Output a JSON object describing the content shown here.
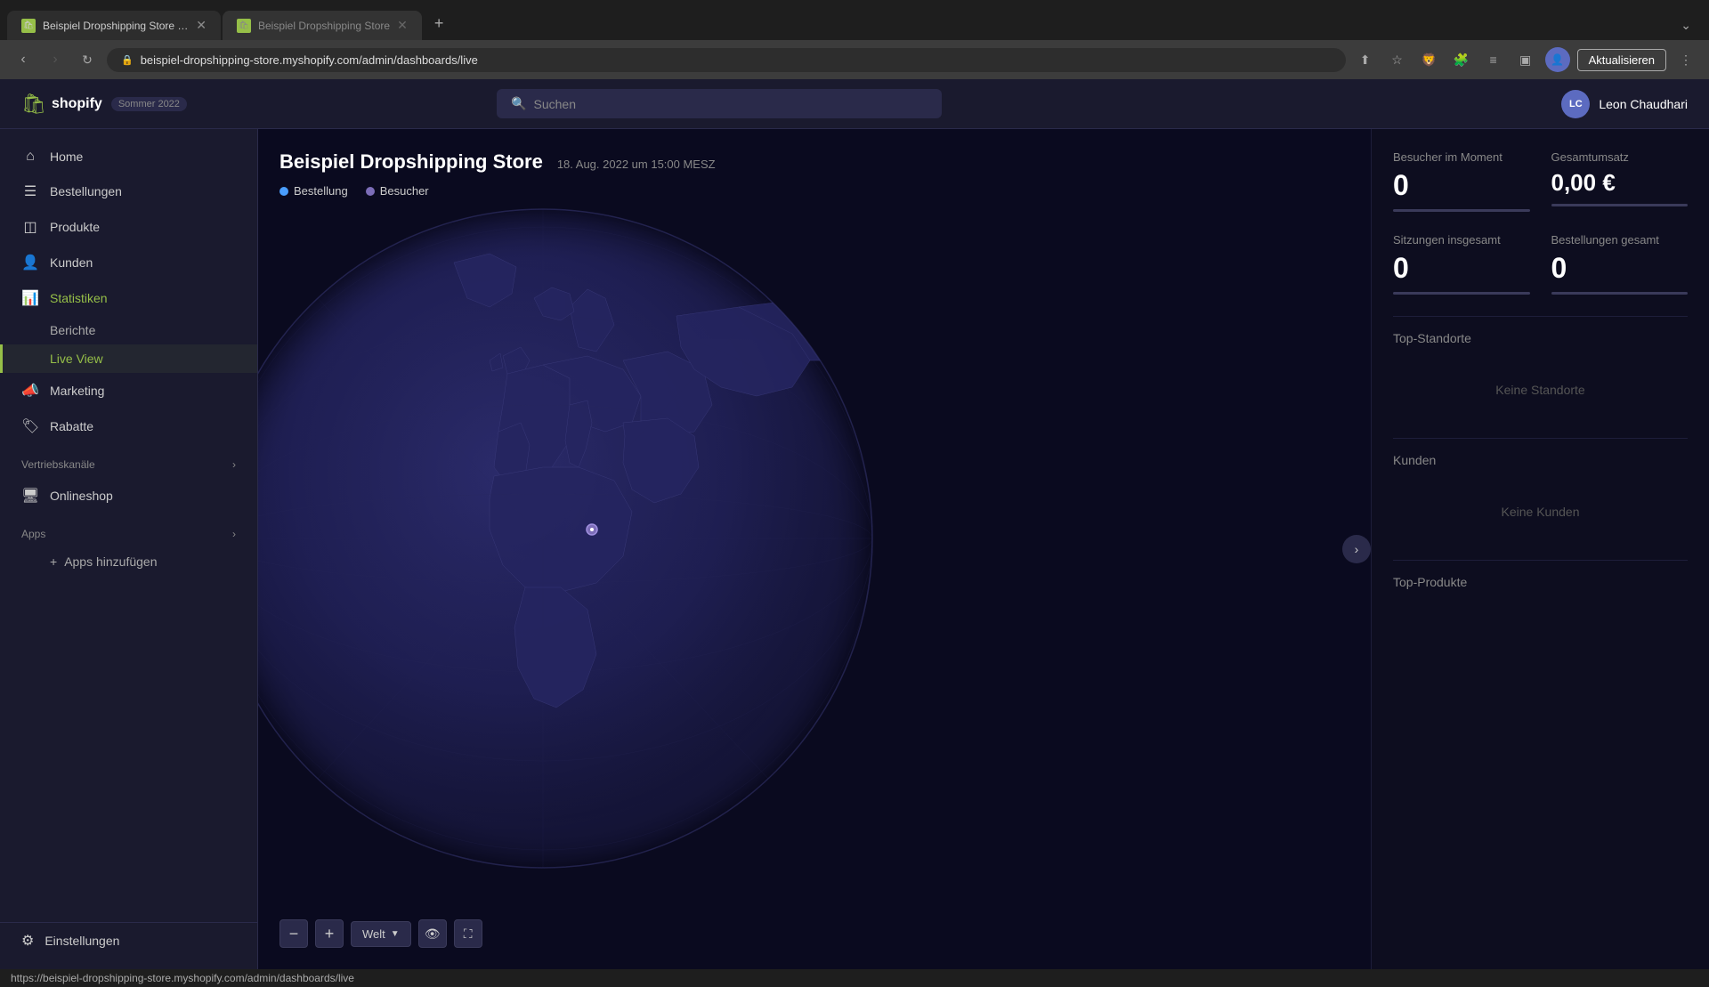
{
  "browser": {
    "tabs": [
      {
        "id": "tab1",
        "title": "Beispiel Dropshipping Store ·...",
        "favicon": "🛍",
        "active": true
      },
      {
        "id": "tab2",
        "title": "Beispiel Dropshipping Store",
        "favicon": "🛍",
        "active": false
      }
    ],
    "new_tab_label": "+",
    "tab_menu_label": "⌄",
    "address": "beispiel-dropshipping-store.myshopify.com/admin/dashboards/live",
    "update_button_label": "Aktualisieren",
    "status_bar_url": "https://beispiel-dropshipping-store.myshopify.com/admin/dashboards/live"
  },
  "header": {
    "logo_label": "shopify",
    "summer_badge": "Sommer 2022",
    "search_placeholder": "Suchen",
    "user_initials": "LC",
    "user_name": "Leon Chaudhari"
  },
  "sidebar": {
    "nav_items": [
      {
        "id": "home",
        "label": "Home",
        "icon": "⌂",
        "active": false
      },
      {
        "id": "bestellungen",
        "label": "Bestellungen",
        "icon": "☰",
        "active": false
      },
      {
        "id": "produkte",
        "label": "Produkte",
        "icon": "◫",
        "active": false
      },
      {
        "id": "kunden",
        "label": "Kunden",
        "icon": "👤",
        "active": false
      },
      {
        "id": "statistiken",
        "label": "Statistiken",
        "icon": "📊",
        "active": true
      }
    ],
    "sub_items": [
      {
        "id": "berichte",
        "label": "Berichte",
        "active": false
      },
      {
        "id": "live-view",
        "label": "Live View",
        "active": true
      }
    ],
    "more_nav_items": [
      {
        "id": "marketing",
        "label": "Marketing",
        "icon": "📣",
        "active": false
      },
      {
        "id": "rabatte",
        "label": "Rabatte",
        "icon": "🏷",
        "active": false
      }
    ],
    "vertriebskanaele_label": "Vertriebskanäle",
    "vertriebskanaele_expand": "›",
    "vertrieb_items": [
      {
        "id": "onlineshop",
        "label": "Onlineshop",
        "icon": "🖥",
        "active": false
      }
    ],
    "apps_label": "Apps",
    "apps_expand": "›",
    "add_apps_label": "Apps hinzufügen",
    "settings_label": "Einstellungen",
    "settings_icon": "⚙"
  },
  "map": {
    "store_name": "Beispiel Dropshipping Store",
    "timestamp": "18. Aug. 2022 um 15:00 MESZ",
    "legend_bestellung": "Bestellung",
    "legend_besucher": "Besucher",
    "controls": {
      "zoom_out": "−",
      "zoom_in": "+",
      "world_label": "Welt",
      "eye_icon": "👁",
      "fullscreen_icon": "⛶"
    },
    "nav_arrow": "›"
  },
  "right_panel": {
    "stats": [
      {
        "id": "besucher",
        "label": "Besucher im Moment",
        "value": "0",
        "currency": false
      },
      {
        "id": "gesamtumsatz",
        "label": "Gesamtumsatz",
        "value": "0,00 €",
        "currency": true
      },
      {
        "id": "sitzungen",
        "label": "Sitzungen insgesamt",
        "value": "0",
        "currency": false
      },
      {
        "id": "bestellungen",
        "label": "Bestellungen gesamt",
        "value": "0",
        "currency": false
      }
    ],
    "top_standorte_label": "Top-Standorte",
    "keine_standorte": "Keine Standorte",
    "kunden_label": "Kunden",
    "keine_kunden": "Keine Kunden",
    "top_produkte_label": "Top-Produkte"
  }
}
